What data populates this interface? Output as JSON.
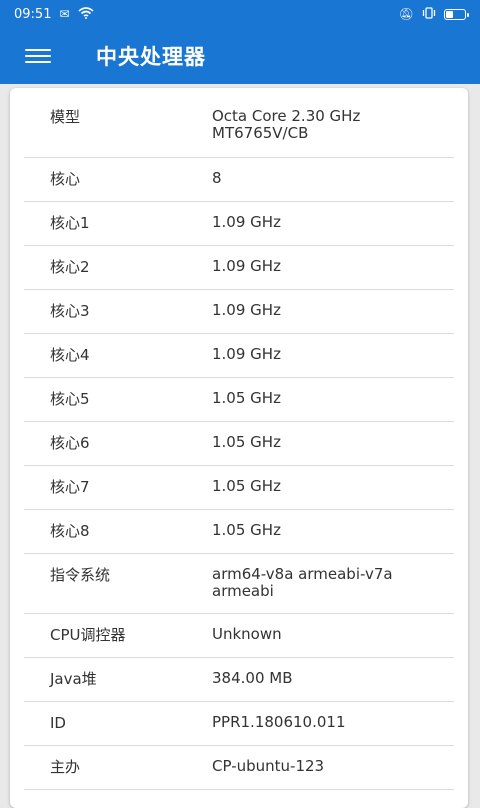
{
  "status_bar": {
    "time": "09:51",
    "notification_icon": "notification-icon",
    "wifi_icon": "wifi-icon",
    "mute_icon": "mute-icon",
    "vibrate_icon": "vibrate-icon",
    "battery_icon": "battery-icon"
  },
  "app_bar": {
    "menu_icon": "hamburger-menu-icon",
    "title": "中央处理器",
    "color": "#1976d2"
  },
  "rows": [
    {
      "label": "模型",
      "value": "Octa Core 2.30 GHz MT6765V/CB"
    },
    {
      "label": "核心",
      "value": "8"
    },
    {
      "label": "核心1",
      "value": "1.09 GHz"
    },
    {
      "label": "核心2",
      "value": "1.09 GHz"
    },
    {
      "label": "核心3",
      "value": "1.09 GHz"
    },
    {
      "label": "核心4",
      "value": "1.09 GHz"
    },
    {
      "label": "核心5",
      "value": "1.05 GHz"
    },
    {
      "label": "核心6",
      "value": "1.05 GHz"
    },
    {
      "label": "核心7",
      "value": "1.05 GHz"
    },
    {
      "label": "核心8",
      "value": "1.05 GHz"
    },
    {
      "label": "指令系统",
      "value": "arm64-v8a armeabi-v7a armeabi"
    },
    {
      "label": "CPU调控器",
      "value": "Unknown"
    },
    {
      "label": "Java堆",
      "value": "384.00 MB"
    },
    {
      "label": "ID",
      "value": "PPR1.180610.011"
    },
    {
      "label": "主办",
      "value": "CP-ubuntu-123"
    }
  ]
}
